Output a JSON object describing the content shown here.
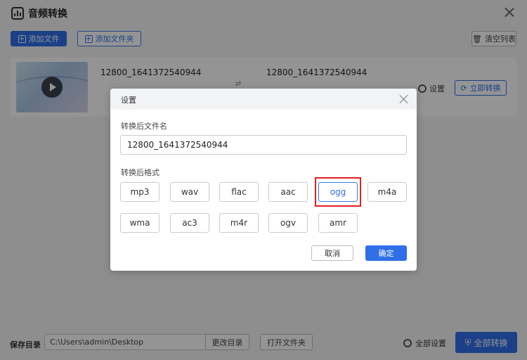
{
  "app": {
    "title": "音频转换"
  },
  "toolbar": {
    "add_file": "添加文件",
    "add_folder": "添加文件夹",
    "clear_list": "清空列表"
  },
  "file_item": {
    "source_name": "12800_1641372540944",
    "target_name": "12800_1641372540944",
    "settings_label": "设置",
    "convert_now_label": "立即转换"
  },
  "bottom": {
    "save_dir_label": "保存目录",
    "save_dir_value": "C:\\Users\\admin\\Desktop",
    "change_dir_label": "更改目录",
    "open_folder_label": "打开文件夹",
    "all_settings_label": "全部设置",
    "convert_all_label": "全部转换"
  },
  "dialog": {
    "title": "设置",
    "filename_label": "转换后文件名",
    "filename_value": "12800_1641372540944",
    "format_label": "转换后格式",
    "formats": [
      "mp3",
      "wav",
      "flac",
      "aac",
      "ogg",
      "m4a",
      "wma",
      "ac3",
      "m4r",
      "ogv",
      "amr"
    ],
    "selected_format": "ogg",
    "cancel_label": "取消",
    "confirm_label": "确定"
  },
  "colors": {
    "accent": "#2f6fe8",
    "highlight": "#e02020"
  }
}
